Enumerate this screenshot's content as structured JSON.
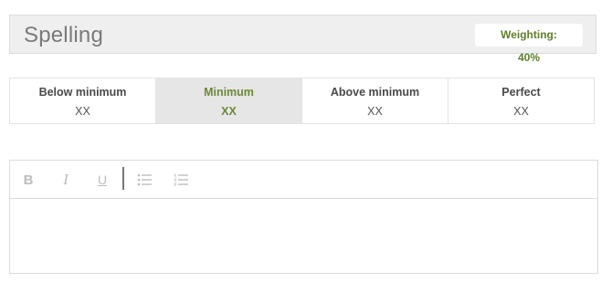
{
  "section": {
    "title": "Spelling",
    "weighting_label": "Weighting: 40%"
  },
  "levels": [
    {
      "name": "Below minimum",
      "value": "XX",
      "selected": false
    },
    {
      "name": "Minimum",
      "value": "XX",
      "selected": true
    },
    {
      "name": "Above minimum",
      "value": "XX",
      "selected": false
    },
    {
      "name": "Perfect",
      "value": "XX",
      "selected": false
    }
  ],
  "toolbar": {
    "bold": "B",
    "italic": "I",
    "underline": "U"
  },
  "colors": {
    "accent": "#6a8a38",
    "header_bg": "#efefef",
    "selected_bg": "#e6e6e6"
  },
  "icons": {
    "bullet_list": "bullet-list-icon",
    "numbered_list": "numbered-list-icon"
  }
}
